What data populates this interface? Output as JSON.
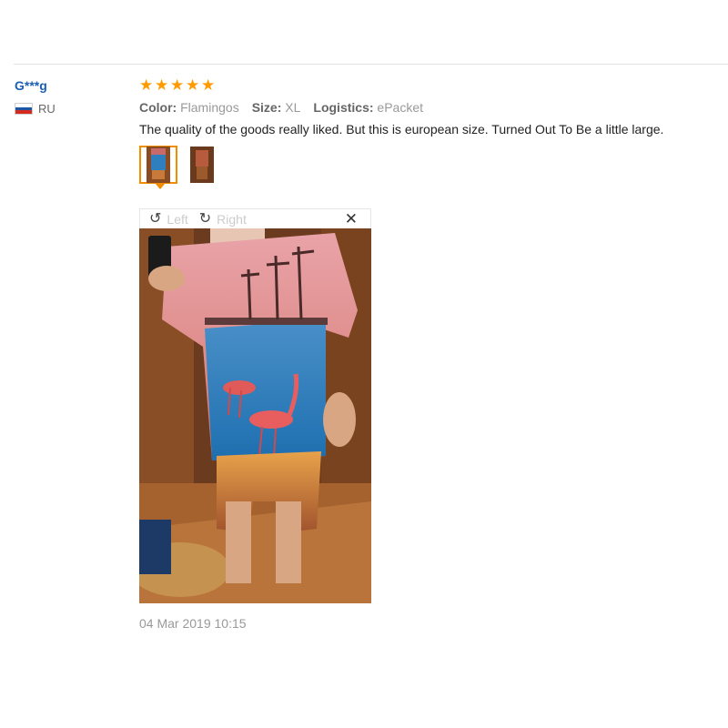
{
  "reviewer": {
    "name": "G***g",
    "country": "RU",
    "flag_colors": [
      "#ffffff",
      "#1c57a5",
      "#d52b1e"
    ]
  },
  "review": {
    "rating": 5,
    "star_color": "#ff9a00",
    "color_label": "Color:",
    "color_value": "Flamingos",
    "size_label": "Size:",
    "size_value": "XL",
    "logistics_label": "Logistics:",
    "logistics_value": "ePacket",
    "text": "The quality of the goods really liked. But this is european size. Turned Out To Be a little large.",
    "date": "04 Mar 2019 10:15"
  },
  "viewer": {
    "rotate_left_label": "Left",
    "rotate_right_label": "Right",
    "rotate_left_icon": "rotate-left-icon",
    "rotate_right_icon": "rotate-right-icon",
    "close_icon": "close-icon",
    "close_glyph": "✕"
  },
  "thumbnails": [
    {
      "name": "photo-1",
      "active": true
    },
    {
      "name": "photo-2",
      "active": false
    }
  ],
  "colors": {
    "accent": "#f28c00",
    "link": "#1a5fb4"
  }
}
